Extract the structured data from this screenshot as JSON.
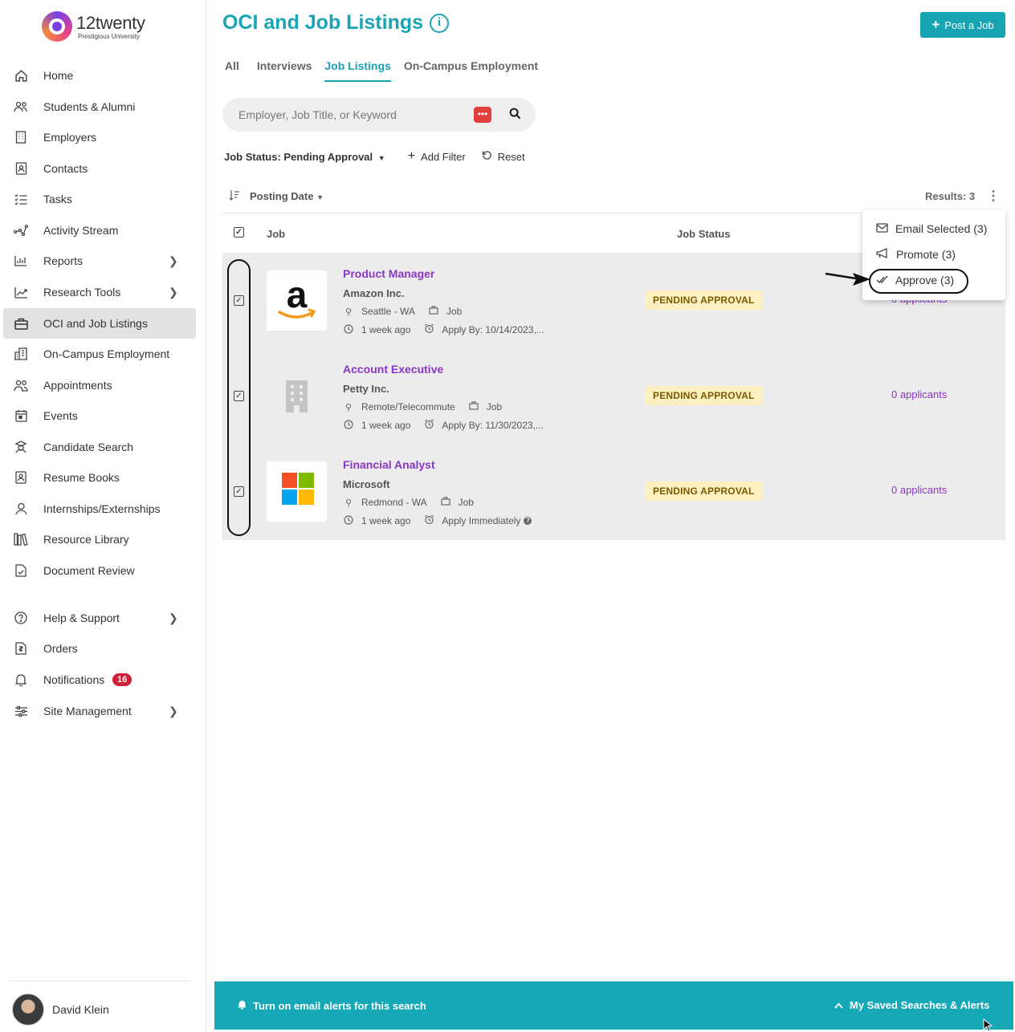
{
  "brand": {
    "name": "12twenty",
    "subtitle": "Prestigious University"
  },
  "sidebar": {
    "items": [
      {
        "label": "Home",
        "icon": "home-icon"
      },
      {
        "label": "Students & Alumni",
        "icon": "people-icon"
      },
      {
        "label": "Employers",
        "icon": "building-icon"
      },
      {
        "label": "Contacts",
        "icon": "contact-icon"
      },
      {
        "label": "Tasks",
        "icon": "tasks-icon"
      },
      {
        "label": "Activity Stream",
        "icon": "activity-icon"
      },
      {
        "label": "Reports",
        "icon": "chart-icon"
      },
      {
        "label": "Research Tools",
        "icon": "research-icon"
      },
      {
        "label": "OCI and Job Listings",
        "icon": "briefcase-icon"
      },
      {
        "label": "On-Campus Employment",
        "icon": "campus-icon"
      },
      {
        "label": "Appointments",
        "icon": "appointments-icon"
      },
      {
        "label": "Events",
        "icon": "calendar-icon"
      },
      {
        "label": "Candidate Search",
        "icon": "candidate-icon"
      },
      {
        "label": "Resume Books",
        "icon": "book-icon"
      },
      {
        "label": "Internships/Externships",
        "icon": "intern-icon"
      },
      {
        "label": "Resource Library",
        "icon": "library-icon"
      },
      {
        "label": "Document Review",
        "icon": "document-icon"
      },
      {
        "label": "Help & Support",
        "icon": "help-icon"
      },
      {
        "label": "Orders",
        "icon": "orders-icon"
      },
      {
        "label": "Notifications",
        "icon": "bell-icon",
        "badge": "16"
      },
      {
        "label": "Site Management",
        "icon": "sliders-icon"
      }
    ],
    "user_name": "David Klein"
  },
  "header": {
    "title": "OCI and Job Listings",
    "post_button": "Post a Job"
  },
  "tabs": [
    "All",
    "Interviews",
    "Job Listings",
    "On-Campus Employment"
  ],
  "search": {
    "placeholder": "Employer, Job Title, or Keyword",
    "dots": "•••"
  },
  "filters": {
    "status": "Job Status: Pending Approval",
    "add": "Add Filter",
    "reset": "Reset"
  },
  "sort": {
    "label": "Posting Date",
    "results": "Results: 3"
  },
  "table": {
    "col_job": "Job",
    "col_status": "Job Status",
    "rows": [
      {
        "title": "Product Manager",
        "company": "Amazon Inc.",
        "location": "Seattle - WA",
        "type": "Job",
        "posted": "1 week ago",
        "apply": "Apply By: 10/14/2023,...",
        "status": "PENDING APPROVAL",
        "applicants": "0 applicants"
      },
      {
        "title": "Account Executive",
        "company": "Petty Inc.",
        "location": "Remote/Telecommute",
        "type": "Job",
        "posted": "1 week ago",
        "apply": "Apply By: 11/30/2023,...",
        "status": "PENDING APPROVAL",
        "applicants": "0 applicants"
      },
      {
        "title": "Financial Analyst",
        "company": "Microsoft",
        "location": "Redmond - WA",
        "type": "Job",
        "posted": "1 week ago",
        "apply": "Apply Immediately",
        "status": "PENDING APPROVAL",
        "applicants": "0 applicants"
      }
    ]
  },
  "menu": {
    "email": "Email Selected (3)",
    "promote": "Promote (3)",
    "approve": "Approve (3)"
  },
  "alertbar": {
    "left": "Turn on email alerts for this search",
    "right": "My Saved Searches & Alerts"
  },
  "colors": {
    "accent": "#16a3b2",
    "link": "#8a36c7",
    "badge": "#d0213a",
    "status_bg": "#fff0c2"
  }
}
